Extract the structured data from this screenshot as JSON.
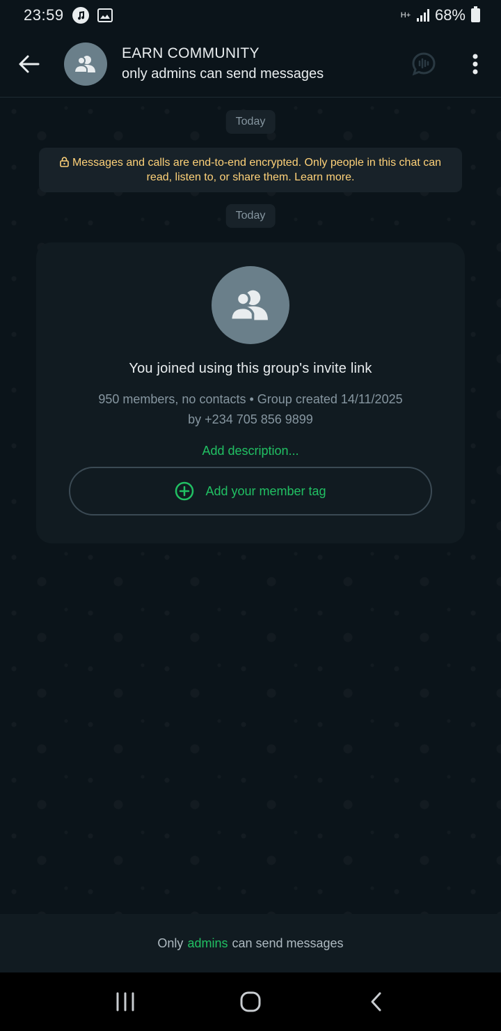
{
  "status_bar": {
    "time": "23:59",
    "network_type": "H+",
    "battery_percent": "68%",
    "icons": [
      "music-icon",
      "image-icon",
      "signal-icon",
      "battery-icon"
    ]
  },
  "header": {
    "title": "EARN COMMUNITY",
    "subtitle": "only admins can send messages",
    "actions": [
      "voice-chat-icon",
      "more-options-icon"
    ]
  },
  "chat": {
    "date_chip_1": "Today",
    "encryption_notice": "Messages and calls are end-to-end encrypted. Only people in this chat can read, listen to, or share them. Learn more.",
    "date_chip_2": "Today",
    "group_card": {
      "title": "You joined using this group's invite link",
      "meta_line_1": "950 members, no contacts • Group created 14/11/2025",
      "meta_line_2": "by +234 705 856 9899",
      "add_description": "Add description...",
      "member_tag_button": "Add your member tag"
    }
  },
  "footer": {
    "prefix": "Only",
    "accent": "admins",
    "suffix": "can send messages"
  },
  "colors": {
    "background": "#0b141a",
    "accent_green": "#21c063",
    "notice_yellow": "#ffd279",
    "avatar_gray": "#6a7f8a"
  }
}
